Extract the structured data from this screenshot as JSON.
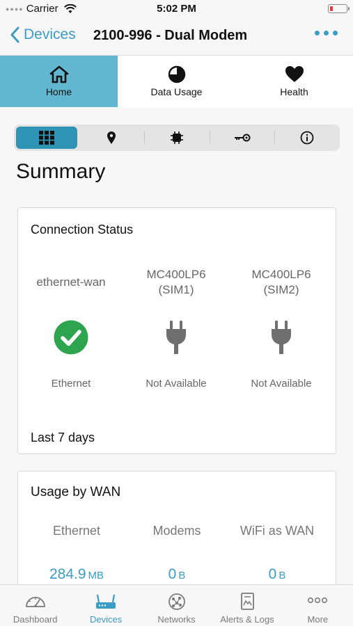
{
  "status_bar": {
    "carrier": "Carrier",
    "time": "5:02 PM"
  },
  "nav": {
    "back_label": "Devices",
    "title": "2100-996 - Dual Modem"
  },
  "top_tabs": [
    {
      "label": "Home",
      "icon": "home-icon",
      "active": true
    },
    {
      "label": "Data Usage",
      "icon": "pie-chart-icon",
      "active": false
    },
    {
      "label": "Health",
      "icon": "heart-icon",
      "active": false
    }
  ],
  "segments": [
    "grid-icon",
    "location-pin-icon",
    "chip-icon",
    "key-icon",
    "info-icon"
  ],
  "summary_title": "Summary",
  "connection_status": {
    "title": "Connection Status",
    "connections": [
      {
        "name": "ethernet-wan",
        "status": "Ethernet",
        "icon": "check-circle-icon"
      },
      {
        "name": "MC400LP6 (SIM1)",
        "status": "Not Available",
        "icon": "plug-icon"
      },
      {
        "name": "MC400LP6 (SIM2)",
        "status": "Not Available",
        "icon": "plug-icon"
      }
    ],
    "footer": "Last 7 days"
  },
  "usage_by_wan": {
    "title": "Usage by WAN",
    "items": [
      {
        "name": "Ethernet",
        "value": "284.9",
        "unit": "MB"
      },
      {
        "name": "Modems",
        "value": "0",
        "unit": "B"
      },
      {
        "name": "WiFi as WAN",
        "value": "0",
        "unit": "B"
      }
    ]
  },
  "bottom_tabs": [
    {
      "label": "Dashboard",
      "icon": "gauge-icon",
      "active": false
    },
    {
      "label": "Devices",
      "icon": "router-icon",
      "active": true
    },
    {
      "label": "Networks",
      "icon": "globe-network-icon",
      "active": false
    },
    {
      "label": "Alerts & Logs",
      "icon": "log-document-icon",
      "active": false
    },
    {
      "label": "More",
      "icon": "more-dots-icon",
      "active": false
    }
  ],
  "colors": {
    "accent": "#3b9cc4",
    "tab_active": "#62b6cf",
    "segment_active": "#2f93b6",
    "success": "#2ea44f"
  }
}
